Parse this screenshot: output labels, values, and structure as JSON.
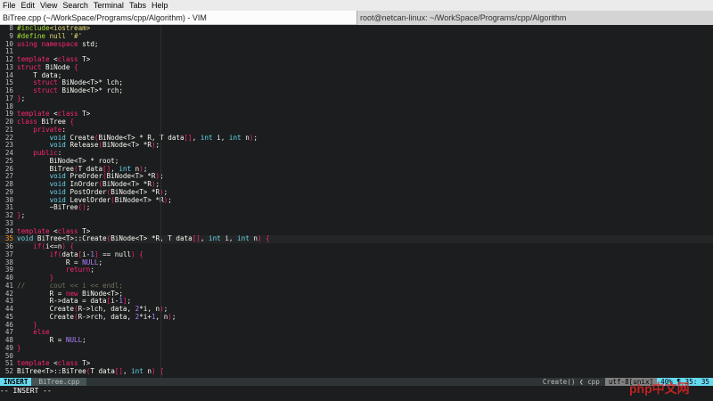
{
  "menubar": [
    "File",
    "Edit",
    "View",
    "Search",
    "Terminal",
    "Tabs",
    "Help"
  ],
  "tabs": {
    "active": "BiTree.cpp (~/WorkSpace/Programs/cpp/Algorithm) - VIM",
    "inactive": "root@netcan-linux: ~/WorkSpace/Programs/cpp/Algorithm"
  },
  "editor": {
    "lines": [
      {
        "n": "8",
        "text": "#include<iostream>"
      },
      {
        "n": "9",
        "text": "#define null '#'"
      },
      {
        "n": "10",
        "text": "using namespace std;"
      },
      {
        "n": "11",
        "text": ""
      },
      {
        "n": "12",
        "text": "template <class T>"
      },
      {
        "n": "13",
        "text": "struct BiNode {"
      },
      {
        "n": "14",
        "text": "    T data;"
      },
      {
        "n": "15",
        "text": "    struct BiNode<T>* lch;"
      },
      {
        "n": "16",
        "text": "    struct BiNode<T>* rch;"
      },
      {
        "n": "17",
        "text": "};"
      },
      {
        "n": "18",
        "text": ""
      },
      {
        "n": "19",
        "text": "template <class T>"
      },
      {
        "n": "20",
        "text": "class BiTree {"
      },
      {
        "n": "21",
        "text": "    private:"
      },
      {
        "n": "22",
        "text": "        void Create(BiNode<T> * R, T data[], int i, int n);"
      },
      {
        "n": "23",
        "text": "        void Release(BiNode<T> *R);"
      },
      {
        "n": "24",
        "text": "    public:"
      },
      {
        "n": "25",
        "text": "        BiNode<T> * root;"
      },
      {
        "n": "26",
        "text": "        BiTree(T data[], int n);"
      },
      {
        "n": "27",
        "text": "        void PreOrder(BiNode<T> *R);"
      },
      {
        "n": "28",
        "text": "        void InOrder(BiNode<T> *R);"
      },
      {
        "n": "29",
        "text": "        void PostOrder(BiNode<T> *R);"
      },
      {
        "n": "30",
        "text": "        void LevelOrder(BiNode<T> *R);"
      },
      {
        "n": "31",
        "text": "        ~BiTree();"
      },
      {
        "n": "32",
        "text": "};"
      },
      {
        "n": "33",
        "text": ""
      },
      {
        "n": "34",
        "text": "template <class T>"
      },
      {
        "n": "35",
        "text": "void BiTree<T>::Create(BiNode<T> *R, T data[], int i, int n) {",
        "current": true
      },
      {
        "n": "36",
        "text": "    if(i<=n) {"
      },
      {
        "n": "37",
        "text": "        if(data[i-1] == null) {"
      },
      {
        "n": "38",
        "text": "            R = NULL;"
      },
      {
        "n": "39",
        "text": "            return;"
      },
      {
        "n": "40",
        "text": "        }"
      },
      {
        "n": "41",
        "text": "//      cout << i << endl;"
      },
      {
        "n": "42",
        "text": "        R = new BiNode<T>;"
      },
      {
        "n": "43",
        "text": "        R->data = data[i-1];"
      },
      {
        "n": "44",
        "text": "        Create(R->lch, data, 2*i, n);"
      },
      {
        "n": "45",
        "text": "        Create(R->rch, data, 2*i+1, n);"
      },
      {
        "n": "46",
        "text": "    }"
      },
      {
        "n": "47",
        "text": "    else"
      },
      {
        "n": "48",
        "text": "        R = NULL;"
      },
      {
        "n": "49",
        "text": "}"
      },
      {
        "n": "50",
        "text": ""
      },
      {
        "n": "51",
        "text": "template <class T>"
      },
      {
        "n": "52",
        "text": "BiTree<T>::BiTree(T data[], int n) {"
      }
    ]
  },
  "statusline": {
    "mode": "INSERT",
    "filename": "BiTree.cpp",
    "function": "Create() ❮ cpp",
    "encoding": "utf-8[unix]",
    "position": "40% ¶  35: 35"
  },
  "cmdline": "-- INSERT --",
  "watermark": "php中文网"
}
